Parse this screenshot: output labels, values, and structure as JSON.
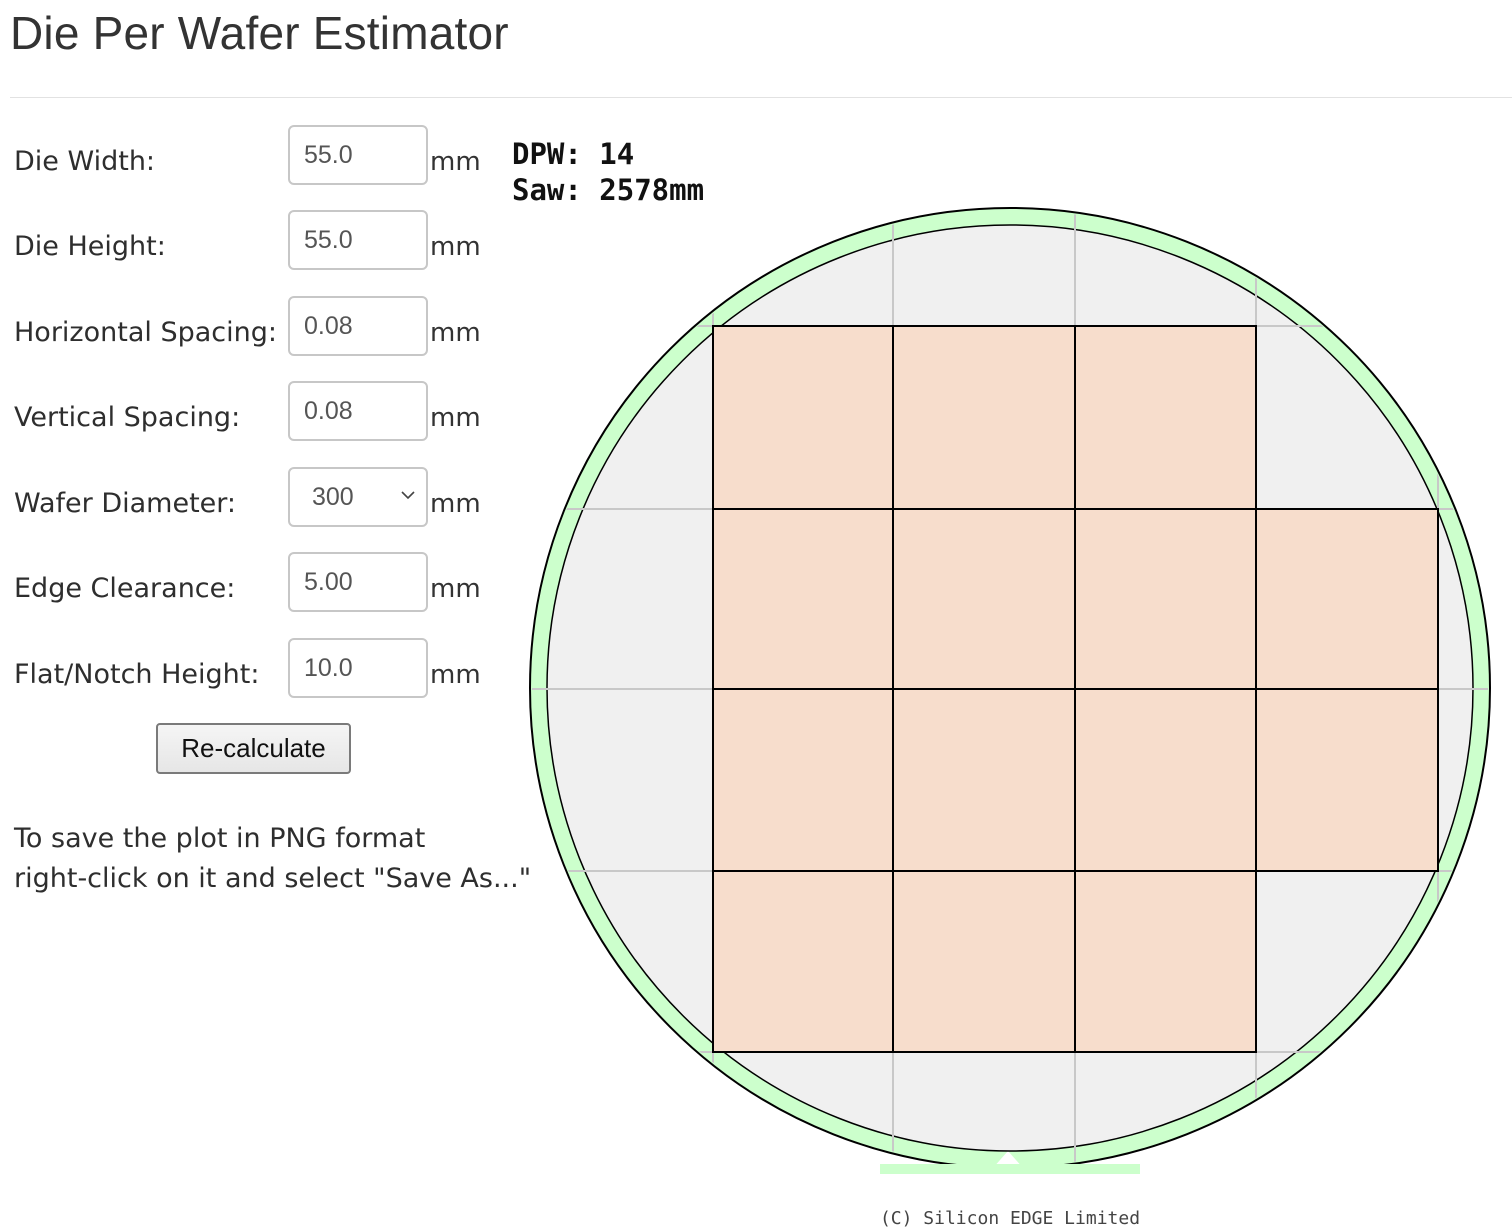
{
  "page": {
    "title": "Die Per Wafer Estimator"
  },
  "form": {
    "fields": [
      {
        "label": "Die Width:",
        "value": "55.0",
        "unit": "mm"
      },
      {
        "label": "Die Height:",
        "value": "55.0",
        "unit": "mm"
      },
      {
        "label": "Horizontal Spacing:",
        "value": "0.08",
        "unit": "mm"
      },
      {
        "label": "Vertical Spacing:",
        "value": "0.08",
        "unit": "mm"
      },
      {
        "label": "Wafer Diameter:",
        "value": "300",
        "unit": "mm",
        "type": "select"
      },
      {
        "label": "Edge Clearance:",
        "value": "5.00",
        "unit": "mm"
      },
      {
        "label": "Flat/Notch Height:",
        "value": "10.0",
        "unit": "mm"
      }
    ],
    "recalculate_label": "Re-calculate",
    "save_hint_lines": [
      "To save the plot in PNG format",
      "right-click on it and select \"Save As...\""
    ]
  },
  "plot": {
    "dpw_text": "DPW: 14",
    "saw_text": "Saw: 2578mm",
    "copyright": "(C) Silicon EDGE Limited",
    "dpw": 14,
    "saw_length_mm": 2578,
    "die_rows": [
      {
        "row": 1,
        "count": 3
      },
      {
        "row": 2,
        "count": 4
      },
      {
        "row": 3,
        "count": 4
      },
      {
        "row": 4,
        "count": 3
      }
    ],
    "colors": {
      "wafer_fill": "#f0f0f0",
      "edge_ring": "#ccffcc",
      "die_fill": "#f7ddcc",
      "die_stroke": "#000000",
      "grid": "#c8c8c8"
    }
  }
}
